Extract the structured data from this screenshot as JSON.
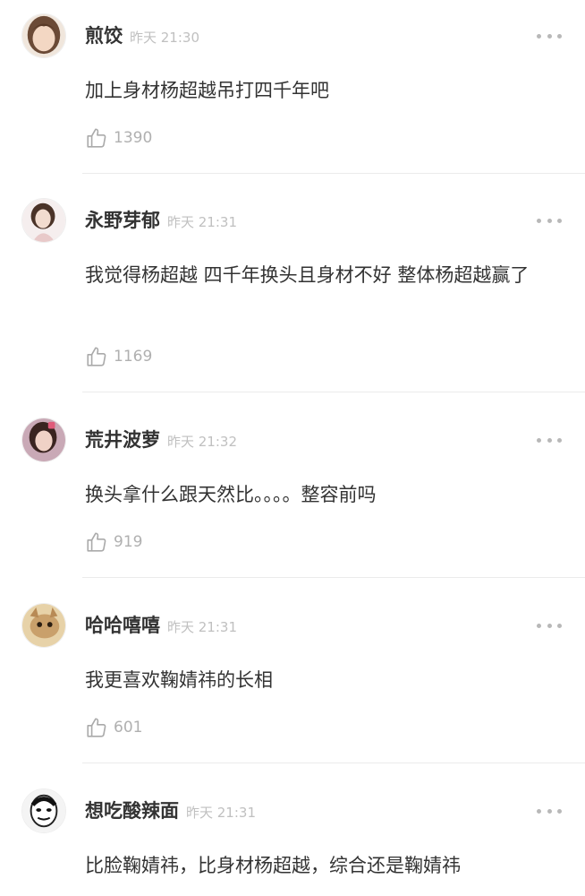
{
  "comments": [
    {
      "name": "煎饺",
      "time": "昨天 21:30",
      "text": "加上身材杨超越吊打四千年吧",
      "likes": "1390"
    },
    {
      "name": "永野芽郁",
      "time": "昨天 21:31",
      "text": "我觉得杨超越 四千年换头且身材不好 整体杨超越赢了",
      "likes": "1169"
    },
    {
      "name": "荒井波萝",
      "time": "昨天 21:32",
      "text": "换头拿什么跟天然比。。。。整容前吗",
      "likes": "919"
    },
    {
      "name": "哈哈嘻嘻",
      "time": "昨天 21:31",
      "text": "我更喜欢鞠婧祎的长相",
      "likes": "601"
    },
    {
      "name": "想吃酸辣面",
      "time": "昨天 21:31",
      "text": "比脸鞠婧祎，比身材杨超越，综合还是鞠婧祎",
      "likes": ""
    }
  ],
  "icons": {
    "like": "thumbs-up-icon",
    "more": "more-dots-icon"
  },
  "colors": {
    "name": "#333333",
    "meta": "#c0c0c0",
    "likes": "#b0b0b0",
    "divider": "#ebebeb"
  }
}
